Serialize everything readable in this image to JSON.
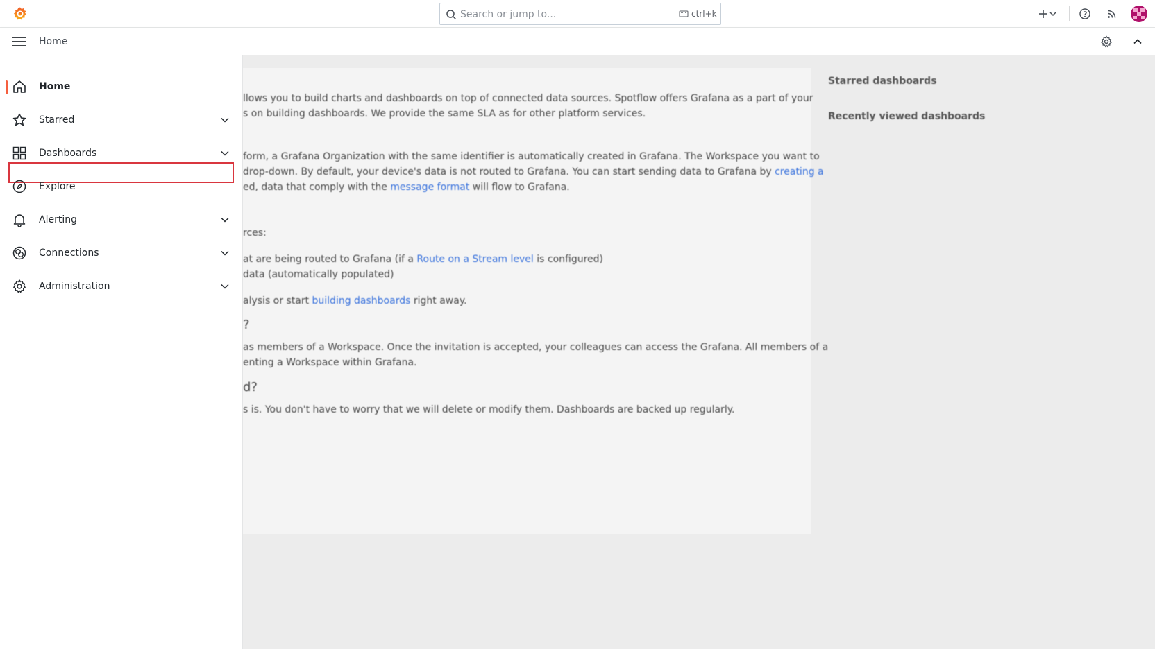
{
  "topbar": {
    "search_placeholder": "Search or jump to...",
    "search_shortcut": "ctrl+k",
    "icons": [
      "grafana-logo-icon",
      "search-icon",
      "keyboard-icon",
      "plus-icon",
      "chevron-down-icon",
      "help-icon",
      "rss-icon",
      "avatar"
    ]
  },
  "breadcrumb": {
    "label": "Home"
  },
  "sidebar": {
    "items": [
      {
        "label": "Home",
        "icon": "home-icon",
        "active": true
      },
      {
        "label": "Starred",
        "icon": "star-icon",
        "expandable": true
      },
      {
        "label": "Dashboards",
        "icon": "apps-icon",
        "expandable": true
      },
      {
        "label": "Explore",
        "icon": "compass-icon",
        "highlighted": true
      },
      {
        "label": "Alerting",
        "icon": "bell-icon",
        "expandable": true
      },
      {
        "label": "Connections",
        "icon": "connections-icon",
        "expandable": true
      },
      {
        "label": "Administration",
        "icon": "cog-icon",
        "expandable": true
      }
    ]
  },
  "background": {
    "lines": [
      "llows you to build charts and dashboards on top of connected data sources. Spotflow offers Grafana as a part of your",
      "s on building dashboards. We provide the same SLA as for other platform services.",
      "form, a Grafana Organization with the same identifier is automatically created in Grafana. The Workspace you want to",
      "drop-down. By default, your device's data is not routed to Grafana. You can start sending data to Grafana by",
      "creating a",
      "ed, data that comply with the",
      "message format",
      "will flow to Grafana.",
      "rces:",
      "at are being routed to Grafana (if a",
      "Route on a Stream level",
      "is configured)",
      "data (automatically populated)",
      "alysis or start",
      "building dashboards",
      "right away.",
      "?",
      "as members of a Workspace. Once the invitation is accepted, your colleagues can access the Grafana. All members of a",
      "enting a Workspace within Grafana.",
      "d?",
      "s is. You don't have to worry that we will delete or modify them. Dashboards are backed up regularly."
    ],
    "starred_title": "Starred dashboards",
    "recent_title": "Recently viewed dashboards"
  },
  "colors": {
    "accent": "#f55f3e",
    "highlight_border": "#d9363f",
    "link": "#3871dc"
  }
}
